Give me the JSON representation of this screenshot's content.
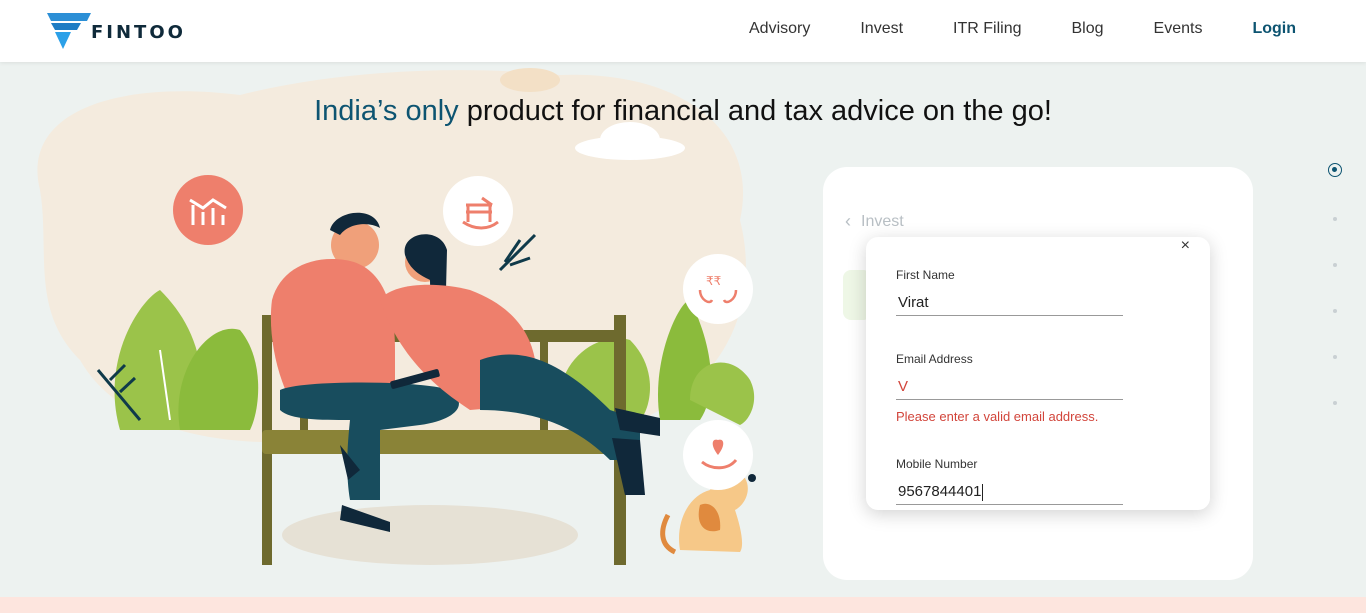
{
  "brand": {
    "name": "FINTOO"
  },
  "nav": {
    "items": [
      "Advisory",
      "Invest",
      "ITR Filing",
      "Blog",
      "Events"
    ],
    "login": "Login"
  },
  "hero": {
    "title_accent": "India’s only",
    "title_rest": " product for financial and tax advice on the go!"
  },
  "card": {
    "back_label": "Invest"
  },
  "modal": {
    "close_glyph": "×",
    "first_name": {
      "label": "First Name",
      "value": "Virat"
    },
    "email": {
      "label": "Email Address",
      "value": "V",
      "error": "Please enter a valid email address."
    },
    "mobile": {
      "label": "Mobile Number",
      "value": "9567844401"
    }
  },
  "colors": {
    "brand": "#0d5471",
    "accent_orange": "#f07f6a",
    "error": "#d2453b"
  },
  "icons": [
    "fintoo-logo-icon",
    "chart-icon",
    "rocking-chair-icon",
    "rupee-hands-icon",
    "plant-hand-icon",
    "chevron-left-icon",
    "close-icon"
  ]
}
